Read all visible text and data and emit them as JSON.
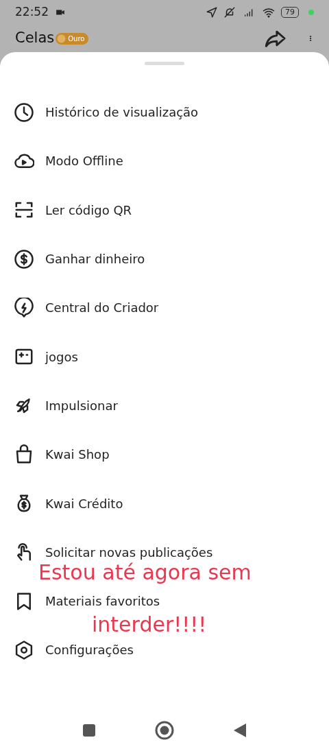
{
  "status_bar": {
    "time": "22:52",
    "battery": "79"
  },
  "header": {
    "title": "Celas",
    "badge": "Ouro"
  },
  "menu": {
    "items": [
      {
        "label": "Histórico de visualização"
      },
      {
        "label": "Modo Offline"
      },
      {
        "label": "Ler código QR"
      },
      {
        "label": "Ganhar dinheiro"
      },
      {
        "label": "Central do Criador"
      },
      {
        "label": "jogos"
      },
      {
        "label": "Impulsionar"
      },
      {
        "label": "Kwai Shop"
      },
      {
        "label": "Kwai Crédito"
      },
      {
        "label": "Solicitar novas publicações"
      },
      {
        "label": "Materiais favoritos"
      },
      {
        "label": "Configurações"
      }
    ]
  },
  "caption": {
    "lines": [
      "Estou até agora sem",
      "interder!!!!"
    ]
  }
}
